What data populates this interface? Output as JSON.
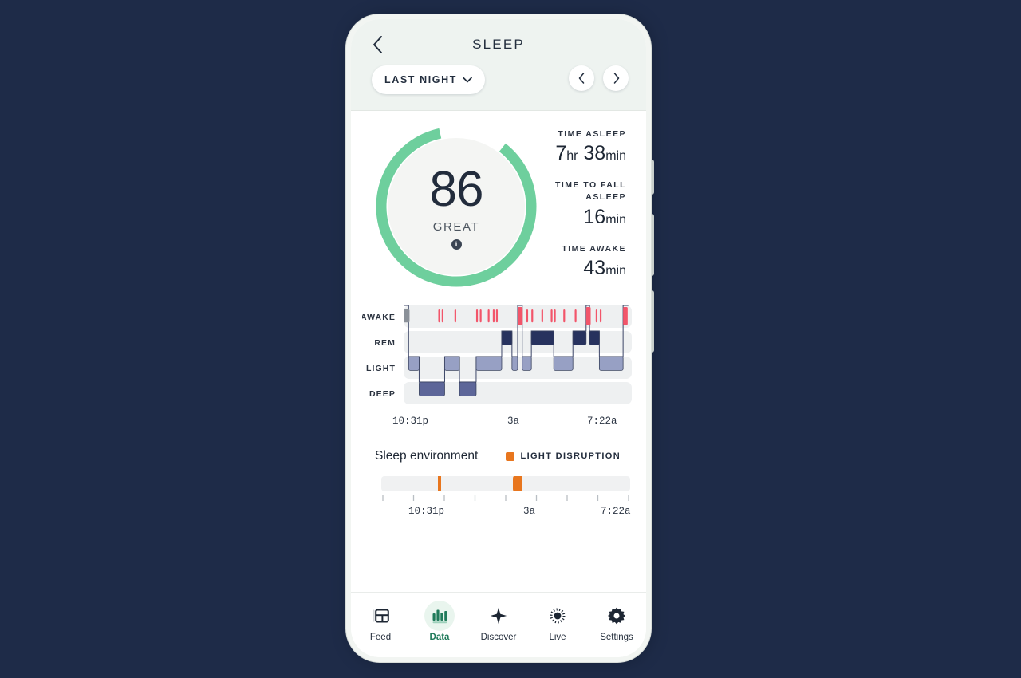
{
  "header": {
    "title": "SLEEP",
    "back_icon": "chevron-left-icon",
    "range_pill": {
      "label": "LAST NIGHT",
      "chevron": "chevron-down-icon"
    },
    "prev_icon": "chevron-left-icon",
    "next_icon": "chevron-right-icon"
  },
  "score": {
    "value": "86",
    "word": "GREAT",
    "info_icon": "info-icon",
    "info_glyph": "i",
    "percent": 86,
    "ring_color": "#6ecf9d",
    "ring_track": "#ffffff"
  },
  "stats": [
    {
      "label": "TIME ASLEEP",
      "value_main": "7",
      "unit1": "hr",
      "value_second": "38",
      "unit2": "min"
    },
    {
      "label": "TIME TO FALL ASLEEP",
      "value_main": "16",
      "unit1": "min",
      "value_second": "",
      "unit2": ""
    },
    {
      "label": "TIME AWAKE",
      "value_main": "43",
      "unit1": "min",
      "value_second": "",
      "unit2": ""
    }
  ],
  "hypnogram": {
    "stages": [
      "AWAKE",
      "REM",
      "LIGHT",
      "DEEP"
    ],
    "time_start": "10:31p",
    "time_mid": "3a",
    "time_end": "7:22a",
    "tick_count": 9,
    "colors": {
      "awake": "#f2556a",
      "awake_start": "#8b9199",
      "rem": "#27325e",
      "light": "#97a0c4",
      "deep": "#5d6699",
      "row_bg": "#eef0f1"
    },
    "segments": [
      {
        "stage": "AWAKE",
        "start": 0.0,
        "end": 0.022
      },
      {
        "stage": "LIGHT",
        "start": 0.022,
        "end": 0.068
      },
      {
        "stage": "DEEP",
        "start": 0.068,
        "end": 0.18
      },
      {
        "stage": "LIGHT",
        "start": 0.18,
        "end": 0.245
      },
      {
        "stage": "DEEP",
        "start": 0.245,
        "end": 0.318
      },
      {
        "stage": "LIGHT",
        "start": 0.318,
        "end": 0.43
      },
      {
        "stage": "REM",
        "start": 0.43,
        "end": 0.475
      },
      {
        "stage": "LIGHT",
        "start": 0.475,
        "end": 0.5
      },
      {
        "stage": "AWAKE",
        "start": 0.5,
        "end": 0.52
      },
      {
        "stage": "LIGHT",
        "start": 0.52,
        "end": 0.56
      },
      {
        "stage": "REM",
        "start": 0.56,
        "end": 0.658
      },
      {
        "stage": "LIGHT",
        "start": 0.658,
        "end": 0.742
      },
      {
        "stage": "REM",
        "start": 0.742,
        "end": 0.8
      },
      {
        "stage": "AWAKE",
        "start": 0.8,
        "end": 0.815
      },
      {
        "stage": "REM",
        "start": 0.815,
        "end": 0.858
      },
      {
        "stage": "LIGHT",
        "start": 0.858,
        "end": 0.962
      },
      {
        "stage": "AWAKE",
        "start": 0.962,
        "end": 0.985
      }
    ],
    "awake_marks": [
      {
        "start": 0.0,
        "width": 0.026,
        "color": "#8b9199"
      },
      {
        "start": 0.152,
        "width": 0.007
      },
      {
        "start": 0.167,
        "width": 0.007
      },
      {
        "start": 0.223,
        "width": 0.007
      },
      {
        "start": 0.318,
        "width": 0.007
      },
      {
        "start": 0.334,
        "width": 0.007
      },
      {
        "start": 0.369,
        "width": 0.007
      },
      {
        "start": 0.391,
        "width": 0.007
      },
      {
        "start": 0.405,
        "width": 0.007
      },
      {
        "start": 0.5,
        "width": 0.022,
        "tall": true
      },
      {
        "start": 0.538,
        "width": 0.007
      },
      {
        "start": 0.56,
        "width": 0.007
      },
      {
        "start": 0.604,
        "width": 0.007
      },
      {
        "start": 0.645,
        "width": 0.007
      },
      {
        "start": 0.659,
        "width": 0.007
      },
      {
        "start": 0.7,
        "width": 0.007
      },
      {
        "start": 0.75,
        "width": 0.007
      },
      {
        "start": 0.8,
        "width": 0.02,
        "tall": true
      },
      {
        "start": 0.842,
        "width": 0.007
      },
      {
        "start": 0.86,
        "width": 0.007
      },
      {
        "start": 0.962,
        "width": 0.02,
        "tall": true
      }
    ]
  },
  "environment": {
    "title": "Sleep environment",
    "legend_label": "LIGHT DISRUPTION",
    "legend_color": "#e8761e",
    "brightness_icon": "brightness-icon",
    "time_start": "10:31p",
    "time_mid": "3a",
    "time_end": "7:22a",
    "tick_count": 9,
    "markers": [
      {
        "start": 0.228,
        "width": 0.012,
        "round": false
      },
      {
        "start": 0.528,
        "width": 0.04,
        "round": true
      }
    ]
  },
  "bottom_nav": {
    "active": "Data",
    "items": [
      {
        "label": "Feed",
        "icon": "feed-layout-icon"
      },
      {
        "label": "Data",
        "icon": "bar-chart-icon"
      },
      {
        "label": "Discover",
        "icon": "compass-star-icon"
      },
      {
        "label": "Live",
        "icon": "live-pulse-icon"
      },
      {
        "label": "Settings",
        "icon": "gear-icon"
      }
    ]
  }
}
